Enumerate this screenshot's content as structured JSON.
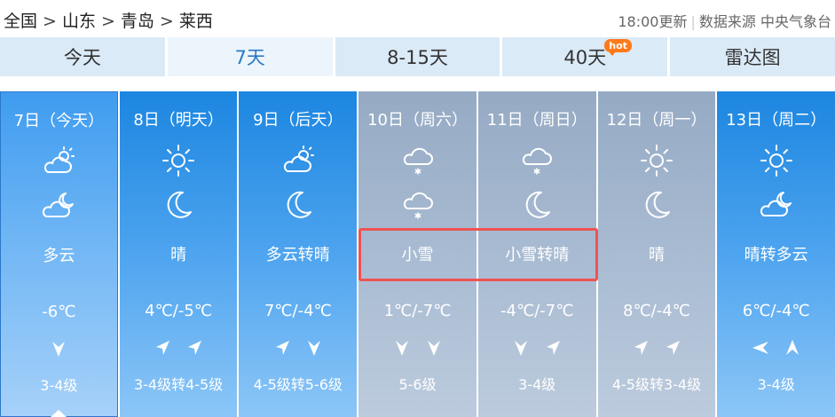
{
  "breadcrumb": [
    "全国",
    "山东",
    "青岛",
    "莱西"
  ],
  "breadcrumb_sep": ">",
  "update_time": "18:00更新",
  "source_label": "数据来源",
  "source_name": "中央气象台",
  "tabs": [
    {
      "label": "今天",
      "active": false
    },
    {
      "label": "7天",
      "active": true
    },
    {
      "label": "8-15天",
      "active": false
    },
    {
      "label": "40天",
      "active": false,
      "badge": "hot"
    },
    {
      "label": "雷达图",
      "active": false
    }
  ],
  "days": [
    {
      "date": "7日（今天）",
      "day_icon": "partly-cloudy-day-icon",
      "night_icon": "partly-cloudy-night-icon",
      "condition": "多云",
      "temp": "-6℃",
      "wind_icons": [
        "wind-north-icon"
      ],
      "wind_level": "3-4级",
      "style": "today"
    },
    {
      "date": "8日（明天）",
      "day_icon": "sunny-icon",
      "night_icon": "moon-icon",
      "condition": "晴",
      "temp": "4℃/-5℃",
      "wind_icons": [
        "wind-southwest-icon",
        "wind-southwest-icon"
      ],
      "wind_level": "3-4级转4-5级",
      "style": "blue"
    },
    {
      "date": "9日（后天）",
      "day_icon": "partly-cloudy-day-icon",
      "night_icon": "moon-icon",
      "condition": "多云转晴",
      "temp": "7℃/-4℃",
      "wind_icons": [
        "wind-southwest-icon",
        "wind-north-icon"
      ],
      "wind_level": "4-5级转5-6级",
      "style": "blue"
    },
    {
      "date": "10日（周六）",
      "day_icon": "light-snow-icon",
      "night_icon": "light-snow-icon",
      "condition": "小雪",
      "temp": "1℃/-7℃",
      "wind_icons": [
        "wind-north-icon",
        "wind-north-icon"
      ],
      "wind_level": "5-6级",
      "style": "gray"
    },
    {
      "date": "11日（周日）",
      "day_icon": "light-snow-icon",
      "night_icon": "moon-icon",
      "condition": "小雪转晴",
      "temp": "-4℃/-7℃",
      "wind_icons": [
        "wind-north-icon",
        "wind-southwest-icon"
      ],
      "wind_level": "3-4级",
      "style": "gray"
    },
    {
      "date": "12日（周一）",
      "day_icon": "sunny-icon",
      "night_icon": "moon-icon",
      "condition": "晴",
      "temp": "8℃/-4℃",
      "wind_icons": [
        "wind-southwest-icon",
        "wind-southwest-icon"
      ],
      "wind_level": "4-5级转3-4级",
      "style": "gray"
    },
    {
      "date": "13日（周二）",
      "day_icon": "sunny-icon",
      "night_icon": "partly-cloudy-night-icon",
      "condition": "晴转多云",
      "temp": "6℃/-4℃",
      "wind_icons": [
        "wind-east-icon",
        "wind-south-icon"
      ],
      "wind_level": "3-4级",
      "style": "blue"
    }
  ],
  "colors": {
    "accent": "#2b78c8",
    "highlight_border": "#f05252",
    "hot_badge": "#ff7a1a",
    "tab_bg": "#dbeaf7"
  }
}
